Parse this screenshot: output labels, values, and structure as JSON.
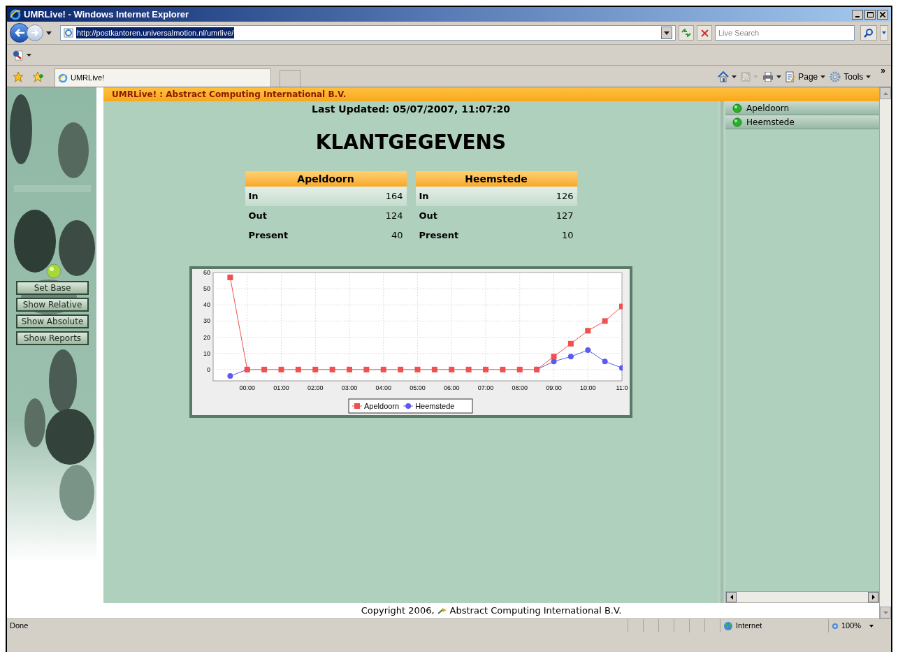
{
  "window": {
    "title": "UMRLive! - Windows Internet Explorer"
  },
  "address_bar": {
    "url": "http://postkantoren.universalmotion.nl/umrlive/"
  },
  "search": {
    "placeholder": "Live Search"
  },
  "tabs": [
    {
      "label": "UMRLive!",
      "selected": true
    }
  ],
  "command_bar": [
    {
      "kind": "home"
    },
    {
      "kind": "feeds",
      "disabled": true
    },
    {
      "kind": "print"
    },
    {
      "kind": "page",
      "label": "Page"
    },
    {
      "kind": "tools",
      "label": "Tools"
    },
    {
      "kind": "overflow",
      "label": "»"
    }
  ],
  "page": {
    "header": "UMRLive! : Abstract Computing International B.V.",
    "last_updated": "Last Updated: 05/07/2007, 11:07:20",
    "heading": "KLANTGEGEVENS",
    "side_buttons": [
      "Set Base",
      "Show Relative",
      "Show Absolute",
      "Show Reports"
    ],
    "locations": [
      {
        "name": "Apeldoorn",
        "rows": [
          {
            "label": "In",
            "value": "164"
          },
          {
            "label": "Out",
            "value": "124"
          },
          {
            "label": "Present",
            "value": "40"
          }
        ]
      },
      {
        "name": "Heemstede",
        "rows": [
          {
            "label": "In",
            "value": "126"
          },
          {
            "label": "Out",
            "value": "127"
          },
          {
            "label": "Present",
            "value": "10"
          }
        ]
      }
    ],
    "chart": {
      "chart_data": {
        "type": "line",
        "x": [
          -0.5,
          0,
          0.5,
          1,
          1.5,
          2,
          2.5,
          3,
          3.5,
          4,
          4.5,
          5,
          5.5,
          6,
          6.5,
          7,
          7.5,
          8,
          8.5,
          9,
          9.5,
          10,
          10.5,
          11
        ],
        "series": [
          {
            "name": "Apeldoorn",
            "color": "#f05050",
            "marker": "square",
            "values": [
              57,
              0,
              0,
              0,
              0,
              0,
              0,
              0,
              0,
              0,
              0,
              0,
              0,
              0,
              0,
              0,
              0,
              0,
              0,
              8,
              16,
              24,
              30,
              39
            ]
          },
          {
            "name": "Heemstede",
            "color": "#5a5af0",
            "marker": "circle",
            "values": [
              -4,
              0,
              null,
              null,
              null,
              null,
              null,
              null,
              null,
              null,
              null,
              null,
              null,
              null,
              null,
              null,
              null,
              null,
              0,
              5,
              8,
              12,
              5,
              1
            ]
          }
        ],
        "grid": true,
        "legend": true,
        "xlim": [
          -1,
          11
        ],
        "ylim": [
          -7,
          60
        ],
        "xticks": [
          {
            "value": 0,
            "label": "00:00"
          },
          {
            "value": 1,
            "label": "01:00"
          },
          {
            "value": 2,
            "label": "02:00"
          },
          {
            "value": 3,
            "label": "03:00"
          },
          {
            "value": 4,
            "label": "04:00"
          },
          {
            "value": 5,
            "label": "05:00"
          },
          {
            "value": 6,
            "label": "06:00"
          },
          {
            "value": 7,
            "label": "07:00"
          },
          {
            "value": 8,
            "label": "08:00"
          },
          {
            "value": 9,
            "label": "09:00"
          },
          {
            "value": 10,
            "label": "10:00"
          },
          {
            "value": 11,
            "label": "11:0"
          }
        ],
        "yticks": [
          0,
          10,
          20,
          30,
          40,
          50,
          60
        ]
      }
    },
    "site_list": [
      "Apeldoorn",
      "Heemstede"
    ],
    "footer": {
      "before": "Copyright 2006,",
      "after": "Abstract Computing International B.V."
    }
  },
  "status_bar": {
    "text": "Done",
    "zone": "Internet",
    "zoom": "100%"
  }
}
